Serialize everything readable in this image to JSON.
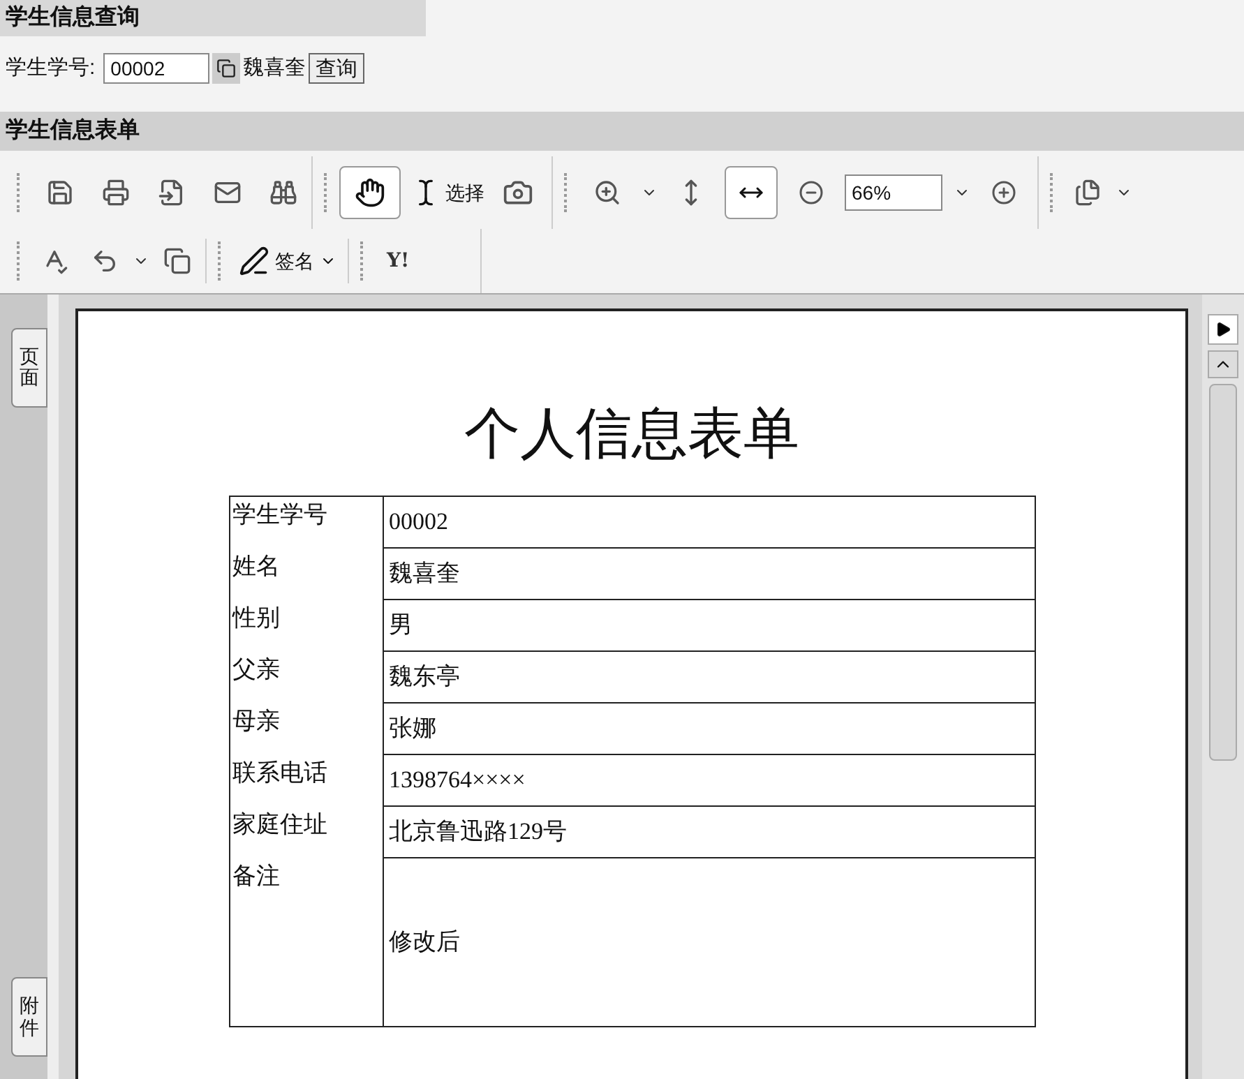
{
  "query_panel": {
    "title": "学生信息查询",
    "label": "学生学号:",
    "student_id": "00002",
    "student_name": "魏喜奎",
    "button": "查询"
  },
  "form_panel": {
    "title": "学生信息表单"
  },
  "toolbar": {
    "hand_tool_selected": true,
    "select_label": "选择",
    "fit_width_selected": true,
    "zoom": "66%",
    "sign_label": "签名",
    "yahoo_label": "Y!"
  },
  "side_tabs": [
    {
      "label": "页面"
    },
    {
      "label": "附件"
    }
  ],
  "document": {
    "title": "个人信息表单",
    "rows": [
      {
        "label": "学生学号",
        "value": "00002"
      },
      {
        "label": "姓名",
        "value": "魏喜奎"
      },
      {
        "label": "性别",
        "value": "男"
      },
      {
        "label": "父亲",
        "value": "魏东亭"
      },
      {
        "label": "母亲",
        "value": "张娜"
      },
      {
        "label": "联系电话",
        "value": "1398764××××"
      },
      {
        "label": "家庭住址",
        "value": "北京鲁迅路129号"
      },
      {
        "label": "备注",
        "value": "修改后",
        "kind": "tall"
      }
    ]
  }
}
